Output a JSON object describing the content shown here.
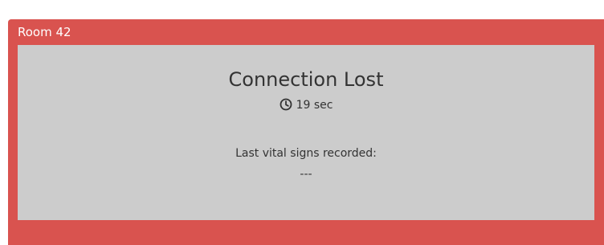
{
  "panel": {
    "title": "Room 42",
    "accent_color": "#d9534f",
    "body_color": "#cccccc"
  },
  "status": {
    "title": "Connection Lost",
    "elapsed_icon": "clock-icon",
    "elapsed": "19 sec"
  },
  "vitals": {
    "label": "Last vital signs recorded:",
    "value": "---"
  }
}
